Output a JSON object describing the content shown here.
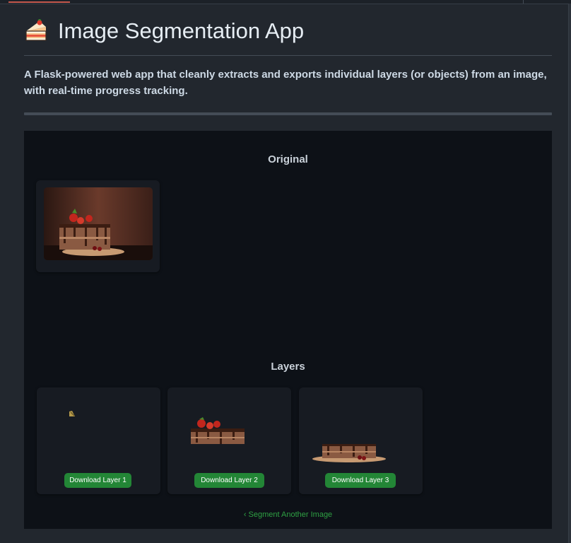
{
  "readme": {
    "title": "Image Segmentation App",
    "icon": "shortcake-emoji",
    "description": "A Flask-powered web app that cleanly extracts and exports individual layers (or objects) from an image, with real-time progress tracking."
  },
  "app": {
    "original_heading": "Original",
    "layers_heading": "Layers",
    "layers": [
      {
        "download_label": "Download Layer 1"
      },
      {
        "download_label": "Download Layer 2"
      },
      {
        "download_label": "Download Layer 3"
      }
    ],
    "back_link": "Segment Another Image",
    "back_icon": "chevron-left-icon"
  },
  "colors": {
    "page_bg": "#22272e",
    "app_bg": "#0d1117",
    "card_bg": "#171b22",
    "button_green": "#238636",
    "link_green": "#2ea043",
    "tab_accent": "#c5584d"
  }
}
